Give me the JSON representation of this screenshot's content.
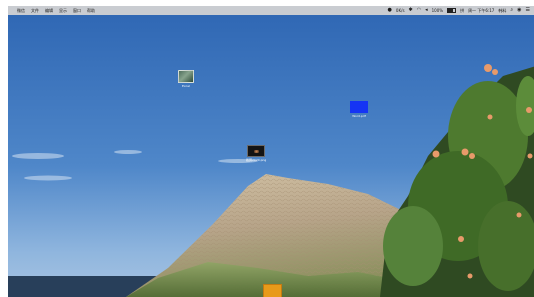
{
  "menubar": {
    "apple_glyph": "",
    "menus": [
      "微信",
      "文件",
      "编辑",
      "显示",
      "窗口",
      "帮助"
    ],
    "status": {
      "wechat_glyph": "●",
      "network_speed": "0K/s",
      "bluetooth_glyph": "✱",
      "wifi_glyph": "◠",
      "volume_glyph": "◂",
      "battery_percent": "100%",
      "input_method": "拼",
      "datetime": "周一 下午6:17",
      "username": "韩料",
      "search_glyph": "⌕",
      "siri_glyph": "◉",
      "control_glyph": "☰"
    }
  },
  "desktop": {
    "icons": [
      {
        "label": "Excel"
      },
      {
        "label": "Word.pdf"
      },
      {
        "label": "截屏2020.png"
      }
    ]
  },
  "colors": {
    "sky_top": "#2f67b4",
    "sky_bottom": "#8fb6df",
    "menubar": "#c9ccd1",
    "orange_item": "#e89a1a"
  }
}
